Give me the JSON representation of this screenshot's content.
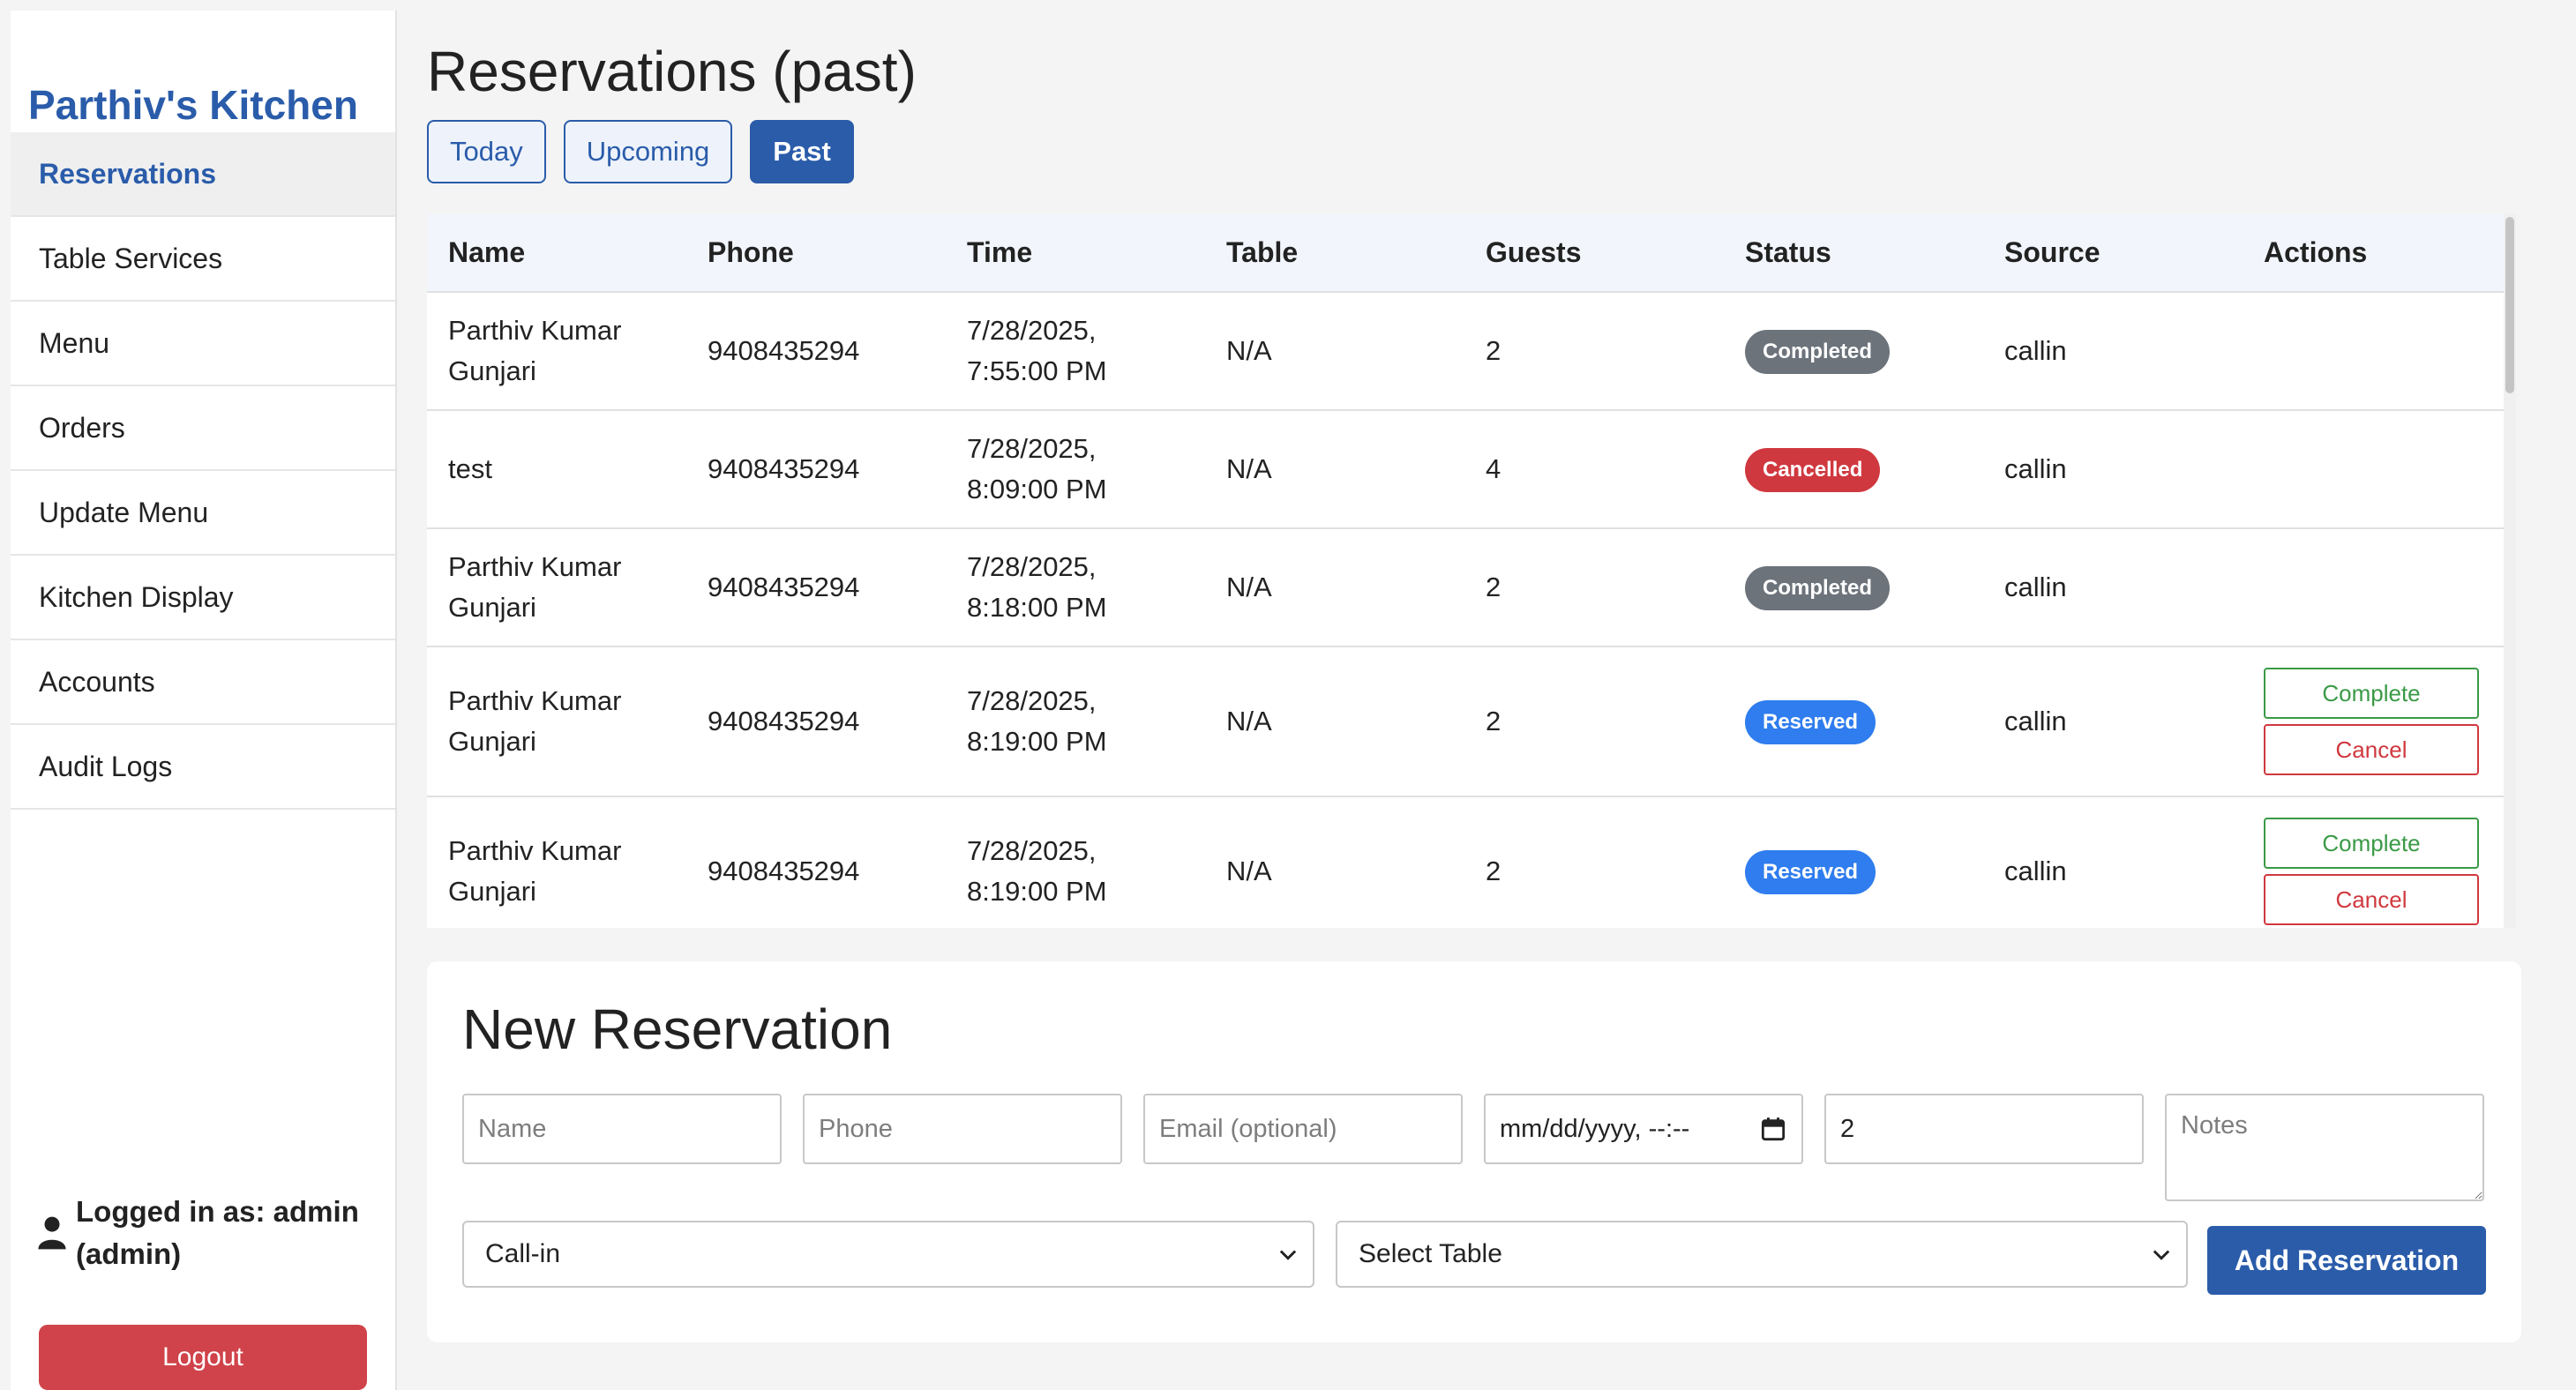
{
  "sidebar": {
    "brand": "Parthiv's Kitchen",
    "items": [
      {
        "label": "Reservations",
        "active": true
      },
      {
        "label": "Table Services"
      },
      {
        "label": "Menu"
      },
      {
        "label": "Orders"
      },
      {
        "label": "Update Menu"
      },
      {
        "label": "Kitchen Display"
      },
      {
        "label": "Accounts"
      },
      {
        "label": "Audit Logs"
      }
    ],
    "logged_in_line1": "Logged in as: admin",
    "logged_in_line2": "(admin)",
    "logout_label": "Logout"
  },
  "main": {
    "title": "Reservations (past)",
    "tabs": [
      {
        "label": "Today"
      },
      {
        "label": "Upcoming"
      },
      {
        "label": "Past",
        "active": true
      }
    ]
  },
  "table": {
    "columns": [
      "Name",
      "Phone",
      "Time",
      "Table",
      "Guests",
      "Status",
      "Source",
      "Actions"
    ],
    "rows": [
      {
        "name_1": "Parthiv Kumar",
        "name_2": "Gunjari",
        "phone": "9408435294",
        "time_1": "7/28/2025,",
        "time_2": "7:55:00 PM",
        "table": "N/A",
        "guests": "2",
        "status": "Completed",
        "source": "callin"
      },
      {
        "name_1": "test",
        "name_2": "",
        "phone": "9408435294",
        "time_1": "7/28/2025,",
        "time_2": "8:09:00 PM",
        "table": "N/A",
        "guests": "4",
        "status": "Cancelled",
        "source": "callin"
      },
      {
        "name_1": "Parthiv Kumar",
        "name_2": "Gunjari",
        "phone": "9408435294",
        "time_1": "7/28/2025,",
        "time_2": "8:18:00 PM",
        "table": "N/A",
        "guests": "2",
        "status": "Completed",
        "source": "callin"
      },
      {
        "name_1": "Parthiv Kumar",
        "name_2": "Gunjari",
        "phone": "9408435294",
        "time_1": "7/28/2025,",
        "time_2": "8:19:00 PM",
        "table": "N/A",
        "guests": "2",
        "status": "Reserved",
        "source": "callin",
        "complete_label": "Complete",
        "cancel_label": "Cancel"
      },
      {
        "name_1": "Parthiv Kumar",
        "name_2": "Gunjari",
        "phone": "9408435294",
        "time_1": "7/28/2025,",
        "time_2": "8:19:00 PM",
        "table": "N/A",
        "guests": "2",
        "status": "Reserved",
        "source": "callin",
        "complete_label": "Complete",
        "cancel_label": "Cancel"
      }
    ]
  },
  "form": {
    "title": "New Reservation",
    "name_placeholder": "Name",
    "phone_placeholder": "Phone",
    "email_placeholder": "Email (optional)",
    "datetime_value": "mm/dd/yyyy, --:--",
    "guests_value": "2",
    "notes_placeholder": "Notes",
    "source_selected": "Call-in",
    "table_selected": "Select Table",
    "add_label": "Add Reservation"
  },
  "colors": {
    "brand": "#2a5caa",
    "completed": "#6c737b",
    "cancelled": "#d0383f",
    "reserved": "#2f7dee",
    "logout": "#d0434a"
  },
  "icons": [
    "user-icon",
    "calendar-icon",
    "chevron-down-icon"
  ]
}
